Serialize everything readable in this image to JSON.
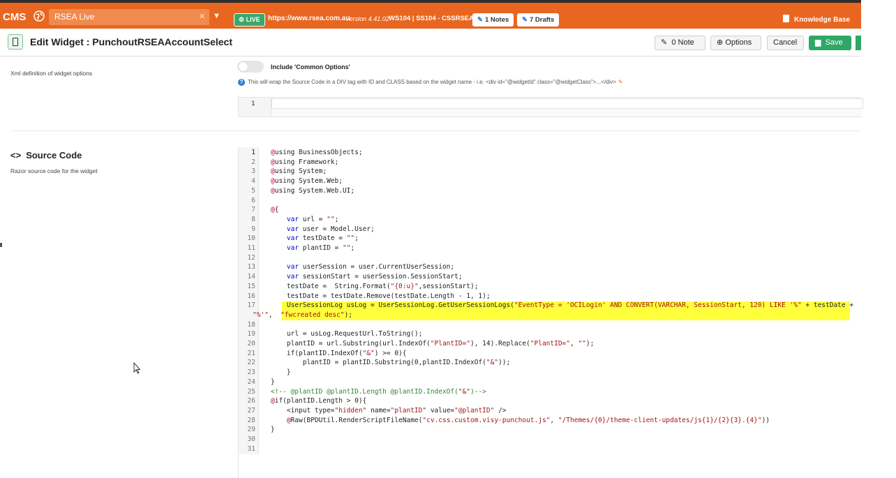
{
  "topbar": {
    "brand": "CMS",
    "site": "RSEA Live",
    "live_badge": "LIVE",
    "url": "https://www.rsea.com.au",
    "version": "Version 4.41.02",
    "server": "WS104 | SS104 - CSSRSEA",
    "notes_label": "1 Notes",
    "drafts_label": "7 Drafts",
    "knowledge_base": "Knowledge Base"
  },
  "editbar": {
    "title": "Edit Widget : PunchoutRSEAAccountSelect",
    "note_label": "0 Note",
    "options_label": "Options",
    "cancel_label": "Cancel",
    "save_label": "Save"
  },
  "options_section": {
    "description": "Xml definition of widget options",
    "toggle_label": "Include 'Common Options'",
    "toggle_on": false,
    "info": "This will wrap the Source Code in a DIV tag with ID and CLASS based on the widget name - i.e. <div id=\"@widgetId\" class=\"@widgetClass\">...</div>",
    "line_number": "1"
  },
  "source_section": {
    "title": "Source Code",
    "description": "Razor source code for the widget",
    "highlighted_line": 17,
    "lines": [
      {
        "n": "1",
        "code": "@using BusinessObjects;"
      },
      {
        "n": "2",
        "code": "@using Framework;"
      },
      {
        "n": "3",
        "code": "@using System;"
      },
      {
        "n": "4",
        "code": "@using System.Web;"
      },
      {
        "n": "5",
        "code": "@using System.Web.UI;"
      },
      {
        "n": "6",
        "code": ""
      },
      {
        "n": "7",
        "code": "@{"
      },
      {
        "n": "8",
        "code": "    var url = \"\";"
      },
      {
        "n": "9",
        "code": "    var user = Model.User;"
      },
      {
        "n": "10",
        "code": "    var testDate = \"\";"
      },
      {
        "n": "11",
        "code": "    var plantID = \"\";"
      },
      {
        "n": "12",
        "code": ""
      },
      {
        "n": "13",
        "code": "    var userSession = user.CurrentUserSession;"
      },
      {
        "n": "14",
        "code": "    var sessionStart = userSession.SessionStart;"
      },
      {
        "n": "15",
        "code": "    testDate =  String.Format(\"{0:u}\",sessionStart);"
      },
      {
        "n": "16",
        "code": "    testDate = testDate.Remove(testDate.Length - 1, 1);"
      },
      {
        "n": "17",
        "code": "    UserSessionLog usLog = UserSessionLog.GetUserSessionLogs(\"EventType = 'OCILogin' AND CONVERT(VARCHAR, SessionStart, 120) LIKE '%\" + testDate +"
      },
      {
        "n": "",
        "code": "\"%'\",  \"fwcreated desc\");"
      },
      {
        "n": "18",
        "code": ""
      },
      {
        "n": "19",
        "code": "    url = usLog.RequestUrl.ToString();"
      },
      {
        "n": "20",
        "code": "    plantID = url.Substring(url.IndexOf(\"PlantID=\"), 14).Replace(\"PlantID=\", \"\");"
      },
      {
        "n": "21",
        "code": "    if(plantID.IndexOf(\"&\") >= 0){"
      },
      {
        "n": "22",
        "code": "        plantID = plantID.Substring(0,plantID.IndexOf(\"&\"));"
      },
      {
        "n": "23",
        "code": "    }"
      },
      {
        "n": "24",
        "code": "}"
      },
      {
        "n": "25",
        "code": "<!-- @plantID @plantID.Length @plantID.IndexOf(\"&\")-->"
      },
      {
        "n": "26",
        "code": "@if(plantID.Length > 0){"
      },
      {
        "n": "27",
        "code": "    <input type=\"hidden\" name=\"plantID\" value=\"@plantID\" />"
      },
      {
        "n": "28",
        "code": "    @Raw(BPDUtil.RenderScriptFileName(\"cv.css.custom.visy-punchout.js\", \"/Themes/{0}/theme-client-updates/js{1}/{2}{3}.{4}\"))"
      },
      {
        "n": "29",
        "code": "}"
      },
      {
        "n": "30",
        "code": ""
      },
      {
        "n": "31",
        "code": ""
      }
    ]
  },
  "colors": {
    "topbar": "#e8661f",
    "save": "#2fa765",
    "highlight": "#ffff3c"
  }
}
